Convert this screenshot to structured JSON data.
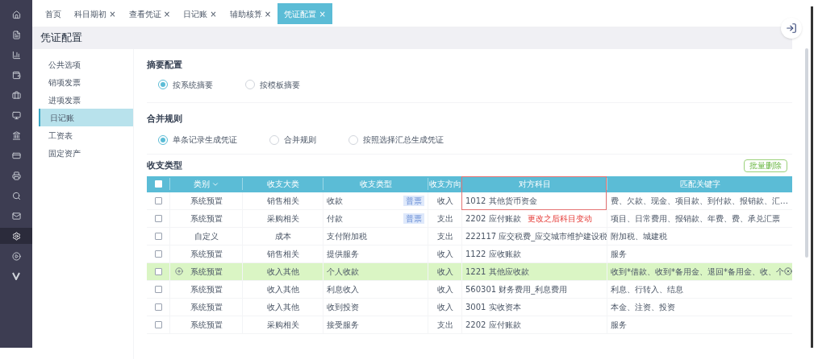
{
  "rail": [
    {
      "selected": false
    },
    {
      "selected": false
    },
    {
      "selected": false
    },
    {
      "selected": false
    },
    {
      "selected": false
    },
    {
      "selected": false
    },
    {
      "selected": false
    },
    {
      "selected": false
    },
    {
      "selected": false
    },
    {
      "selected": false
    },
    {
      "selected": false
    },
    {
      "selected": true
    },
    {
      "selected": false
    },
    {
      "selected": false
    }
  ],
  "tabs": [
    {
      "label": "首页",
      "closable": false,
      "selected": false
    },
    {
      "label": "科目期初",
      "closable": true,
      "selected": false
    },
    {
      "label": "查看凭证",
      "closable": true,
      "selected": false
    },
    {
      "label": "日记账",
      "closable": true,
      "selected": false
    },
    {
      "label": "辅助核算",
      "closable": true,
      "selected": false
    },
    {
      "label": "凭证配置",
      "closable": true,
      "selected": true
    }
  ],
  "close_mark": "×",
  "page_title": "凭证配置",
  "menu": [
    {
      "label": "公共选项",
      "selected": false
    },
    {
      "label": "销项发票",
      "selected": false
    },
    {
      "label": "进项发票",
      "selected": false
    },
    {
      "label": "日记账",
      "selected": true
    },
    {
      "label": "工资表",
      "selected": false
    },
    {
      "label": "固定资产",
      "selected": false
    }
  ],
  "summary": {
    "title": "摘要配置",
    "options": [
      {
        "label": "按系统摘要",
        "selected": true
      },
      {
        "label": "按模板摘要",
        "selected": false
      }
    ]
  },
  "merge": {
    "title": "合并规则",
    "options": [
      {
        "label": "单条记录生成凭证",
        "selected": true
      },
      {
        "label": "合并规则",
        "selected": false
      },
      {
        "label": "按照选择汇总生成凭证",
        "selected": false
      }
    ]
  },
  "types": {
    "title": "收支类型",
    "batch_button": "批量删除",
    "select_all_checked": false,
    "columns": [
      "类别",
      "收支大类",
      "收支类型",
      "收支方向",
      "对方科目",
      "匹配关键字"
    ],
    "rows": [
      {
        "checked": false,
        "selected": false,
        "category": "系统预置",
        "group": "销售相关",
        "type": "收款",
        "badge": "普票",
        "direction": "收入",
        "account": "1012 其他货币资金",
        "keywords": "费、欠款、现金、项目款、到付款、报销款、汇…",
        "boxed": true
      },
      {
        "checked": false,
        "selected": false,
        "category": "系统预置",
        "group": "采购相关",
        "type": "付款",
        "badge": "普票",
        "direction": "支出",
        "account": "2202 应付账款",
        "note": "更改之后科目变动",
        "keywords": "项目、日常费用、报销款、年费、费、承兑汇票",
        "boxed": false
      },
      {
        "checked": false,
        "selected": false,
        "category": "自定义",
        "group": "成本",
        "type": "支付附加税",
        "direction": "支出",
        "account": "222117 应交税费_应交城市维护建设税",
        "keywords": "附加税、城建税",
        "boxed": false
      },
      {
        "checked": false,
        "selected": false,
        "category": "系统预置",
        "group": "销售相关",
        "type": "提供服务",
        "direction": "收入",
        "account": "1122 应收账款",
        "keywords": "服务",
        "boxed": false
      },
      {
        "checked": false,
        "selected": true,
        "category": "系统预置",
        "group": "收入其他",
        "type": "个人收款",
        "direction": "收入",
        "account": "1221 其他应收款",
        "keywords": "收到*借款、收到*备用金、退回*备用金、收、个",
        "boxed": false
      },
      {
        "checked": false,
        "selected": false,
        "category": "系统预置",
        "group": "收入其他",
        "type": "利息收入",
        "direction": "收入",
        "account": "560301 财务费用_利息费用",
        "keywords": "利息、行转入、结息",
        "boxed": false
      },
      {
        "checked": false,
        "selected": false,
        "category": "系统预置",
        "group": "收入其他",
        "type": "收到投资",
        "direction": "收入",
        "account": "3001 实收资本",
        "keywords": "本金、注资、投资",
        "boxed": false
      },
      {
        "checked": false,
        "selected": false,
        "category": "系统预置",
        "group": "采购相关",
        "type": "接受服务",
        "direction": "支出",
        "account": "2202 应付账款",
        "keywords": "服务",
        "boxed": false
      }
    ]
  }
}
